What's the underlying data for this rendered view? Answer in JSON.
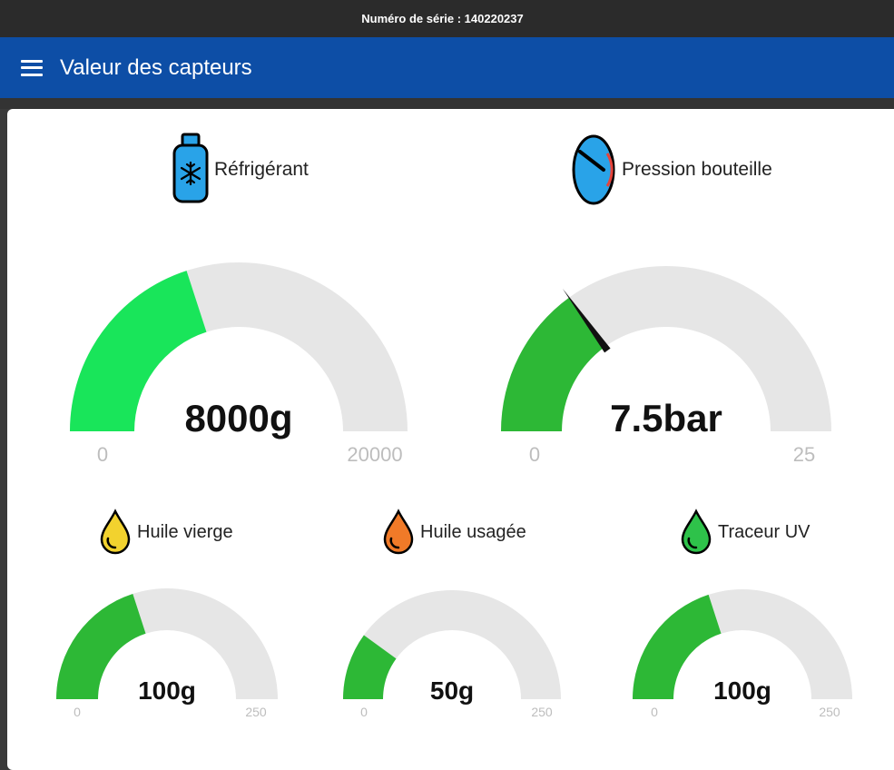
{
  "header": {
    "serial_text": "Numéro de série : 140220237"
  },
  "app_bar": {
    "title": "Valeur des capteurs",
    "menu_icon": "hamburger-menu-icon"
  },
  "colors": {
    "bright_green": "#19e55a",
    "green": "#2db836",
    "track": "#e6e6e6",
    "app_bar": "#0d4ea6",
    "needle": "#111111"
  },
  "gauges": [
    {
      "id": "refrigerant",
      "label": "Réfrigérant",
      "icon": "refrigerant-cylinder-icon",
      "value": 8000,
      "value_text": "8000g",
      "min": "0",
      "max": "20000",
      "min_val": 0,
      "max_val": 20000,
      "color": "#19e55a",
      "needle": false
    },
    {
      "id": "pression",
      "label": "Pression bouteille",
      "icon": "pressure-gauge-icon",
      "value": 7.5,
      "value_text": "7.5bar",
      "min": "0",
      "max": "25",
      "min_val": 0,
      "max_val": 25,
      "color": "#2db836",
      "needle": true
    },
    {
      "id": "huile-vierge",
      "label": "Huile vierge",
      "icon": "yellow-oil-drop-icon",
      "value": 100,
      "value_text": "100g",
      "min": "0",
      "max": "250",
      "min_val": 0,
      "max_val": 250,
      "color": "#2db836",
      "needle": false
    },
    {
      "id": "huile-usagee",
      "label": "Huile usagée",
      "icon": "orange-oil-drop-icon",
      "value": 50,
      "value_text": "50g",
      "min": "0",
      "max": "250",
      "min_val": 0,
      "max_val": 250,
      "color": "#2db836",
      "needle": false
    },
    {
      "id": "traceur-uv",
      "label": "Traceur UV",
      "icon": "green-uv-drop-icon",
      "value": 100,
      "value_text": "100g",
      "min": "0",
      "max": "250",
      "min_val": 0,
      "max_val": 250,
      "color": "#2db836",
      "needle": false
    }
  ]
}
